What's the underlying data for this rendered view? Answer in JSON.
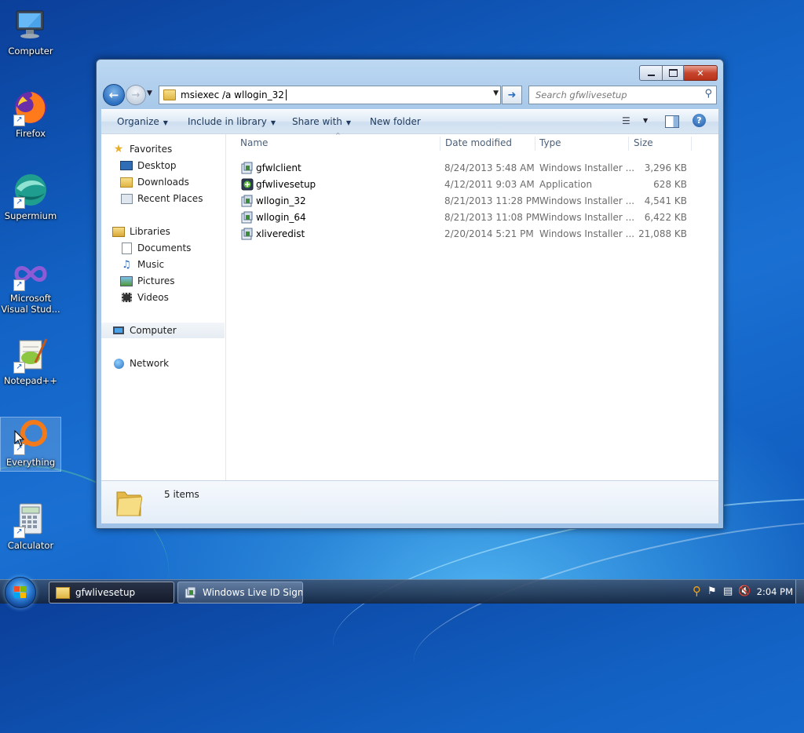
{
  "desktop": {
    "icons": [
      {
        "label": "Computer"
      },
      {
        "label": "Firefox"
      },
      {
        "label": "Supermium"
      },
      {
        "label": "Microsoft Visual Stud..."
      },
      {
        "label": "Notepad++"
      },
      {
        "label": "Everything"
      },
      {
        "label": "Calculator"
      }
    ]
  },
  "explorer": {
    "address_value": "msiexec /a wllogin_32",
    "search_placeholder": "Search gfwlivesetup",
    "toolbar": {
      "organize": "Organize",
      "include_in_library": "Include in library",
      "share_with": "Share with",
      "new_folder": "New folder"
    },
    "nav": {
      "favorites": "Favorites",
      "desktop": "Desktop",
      "downloads": "Downloads",
      "recent_places": "Recent Places",
      "libraries": "Libraries",
      "documents": "Documents",
      "music": "Music",
      "pictures": "Pictures",
      "videos": "Videos",
      "computer": "Computer",
      "network": "Network"
    },
    "columns": {
      "name": "Name",
      "date_modified": "Date modified",
      "type": "Type",
      "size": "Size"
    },
    "files": [
      {
        "name": "gfwlclient",
        "date": "8/24/2013 5:48 AM",
        "type": "Windows Installer ...",
        "size": "3,296 KB",
        "icon": "installer-icon"
      },
      {
        "name": "gfwlivesetup",
        "date": "4/12/2011 9:03 AM",
        "type": "Application",
        "size": "628 KB",
        "icon": "application-icon"
      },
      {
        "name": "wllogin_32",
        "date": "8/21/2013 11:28 PM",
        "type": "Windows Installer ...",
        "size": "4,541 KB",
        "icon": "installer-icon"
      },
      {
        "name": "wllogin_64",
        "date": "8/21/2013 11:08 PM",
        "type": "Windows Installer ...",
        "size": "6,422 KB",
        "icon": "installer-icon"
      },
      {
        "name": "xliveredist",
        "date": "2/20/2014 5:21 PM",
        "type": "Windows Installer ...",
        "size": "21,088 KB",
        "icon": "installer-icon"
      }
    ],
    "details": {
      "item_count": "5 items"
    }
  },
  "taskbar": {
    "buttons": [
      {
        "label": "gfwlivesetup",
        "active": true
      },
      {
        "label": "Windows Live ID Sign...",
        "active": false
      }
    ],
    "clock": "2:04 PM"
  }
}
